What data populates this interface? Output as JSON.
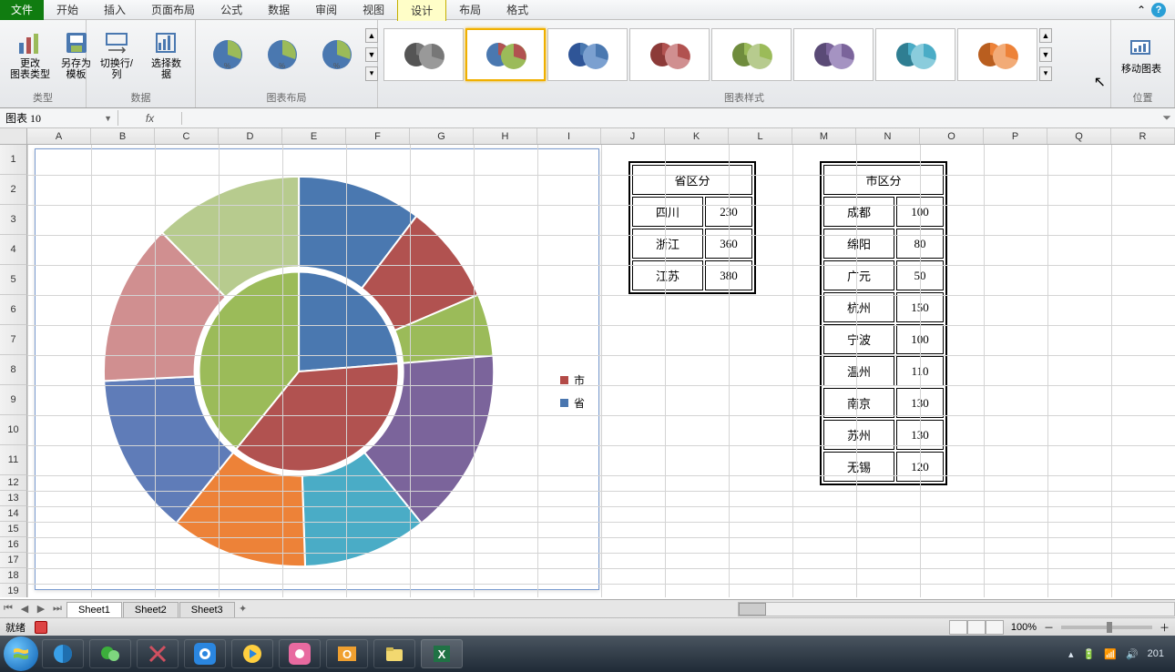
{
  "menubar": {
    "file": "文件",
    "tabs": [
      "开始",
      "插入",
      "页面布局",
      "公式",
      "数据",
      "审阅",
      "视图"
    ],
    "context_tabs": [
      "设计",
      "布局",
      "格式"
    ],
    "active_context_tab": "设计",
    "minimize_aria": "⌃",
    "help_aria": "?"
  },
  "ribbon": {
    "group_type": {
      "label": "类型",
      "change_type": "更改\n图表类型",
      "save_template": "另存为\n模板"
    },
    "group_data": {
      "label": "数据",
      "switch_rc": "切换行/列",
      "select_data": "选择数据"
    },
    "group_layout": {
      "label": "图表布局"
    },
    "group_styles": {
      "label": "图表样式"
    },
    "group_position": {
      "label": "位置",
      "move_chart": "移动图表"
    }
  },
  "namebox": {
    "value": "图表 10"
  },
  "formula": {
    "fx": "fx",
    "value": ""
  },
  "columns": [
    "A",
    "B",
    "C",
    "D",
    "E",
    "F",
    "G",
    "H",
    "I",
    "J",
    "K",
    "L",
    "M",
    "N",
    "O",
    "P",
    "Q",
    "R"
  ],
  "row_numbers_main": [
    1,
    2,
    3,
    4,
    5,
    6,
    7,
    8,
    9,
    10,
    11
  ],
  "row_numbers_small": [
    12,
    13,
    14,
    15,
    16,
    17,
    18,
    19
  ],
  "chart": {
    "legend": [
      {
        "label": "市",
        "color": "#b34a47"
      },
      {
        "label": "省",
        "color": "#4a76af"
      }
    ]
  },
  "chart_data": [
    {
      "type": "pie",
      "title": "",
      "ring": "inner",
      "series_name": "省",
      "categories": [
        "四川",
        "浙江",
        "江苏"
      ],
      "values": [
        230,
        360,
        380
      ],
      "colors": [
        "#4a78b0",
        "#b15250",
        "#9bbb59"
      ]
    },
    {
      "type": "pie",
      "title": "",
      "ring": "outer",
      "series_name": "市",
      "categories": [
        "成都",
        "绵阳",
        "广元",
        "杭州",
        "宁波",
        "温州",
        "南京",
        "苏州",
        "无锡"
      ],
      "values": [
        100,
        80,
        50,
        150,
        100,
        110,
        130,
        130,
        120
      ],
      "colors": [
        "#4a78b0",
        "#b15250",
        "#9bbb59",
        "#7b649b",
        "#4aacc6",
        "#ed8238",
        "#5f7cb8",
        "#d08f90",
        "#b7cb8e"
      ]
    }
  ],
  "table1": {
    "title": "省区分",
    "rows": [
      {
        "name": "四川",
        "val": "230"
      },
      {
        "name": "浙江",
        "val": "360"
      },
      {
        "name": "江苏",
        "val": "380"
      }
    ]
  },
  "table2": {
    "title": "市区分",
    "rows": [
      {
        "name": "成都",
        "val": "100"
      },
      {
        "name": "绵阳",
        "val": "80"
      },
      {
        "name": "广元",
        "val": "50"
      },
      {
        "name": "杭州",
        "val": "150"
      },
      {
        "name": "宁波",
        "val": "100"
      },
      {
        "name": "温州",
        "val": "110"
      },
      {
        "name": "南京",
        "val": "130"
      },
      {
        "name": "苏州",
        "val": "130"
      },
      {
        "name": "无锡",
        "val": "120"
      }
    ]
  },
  "sheets": {
    "tabs": [
      "Sheet1",
      "Sheet2",
      "Sheet3"
    ],
    "active": "Sheet1"
  },
  "status": {
    "ready": "就绪",
    "zoom": "100%",
    "clock_partial": "201"
  },
  "style_thumb_palettes": [
    [
      "#555",
      "#777",
      "#999"
    ],
    [
      "#4a78b0",
      "#b15250",
      "#9bbb59"
    ],
    [
      "#2f5597",
      "#4a78b0",
      "#7ba0d0"
    ],
    [
      "#8c3a38",
      "#b15250",
      "#d08f90"
    ],
    [
      "#6f8c3d",
      "#9bbb59",
      "#b7cb8e"
    ],
    [
      "#5a4a76",
      "#7b649b",
      "#a593c2"
    ],
    [
      "#2f7e92",
      "#4aacc6",
      "#8accdc"
    ],
    [
      "#b95e1f",
      "#ed8238",
      "#f2ab77"
    ]
  ]
}
